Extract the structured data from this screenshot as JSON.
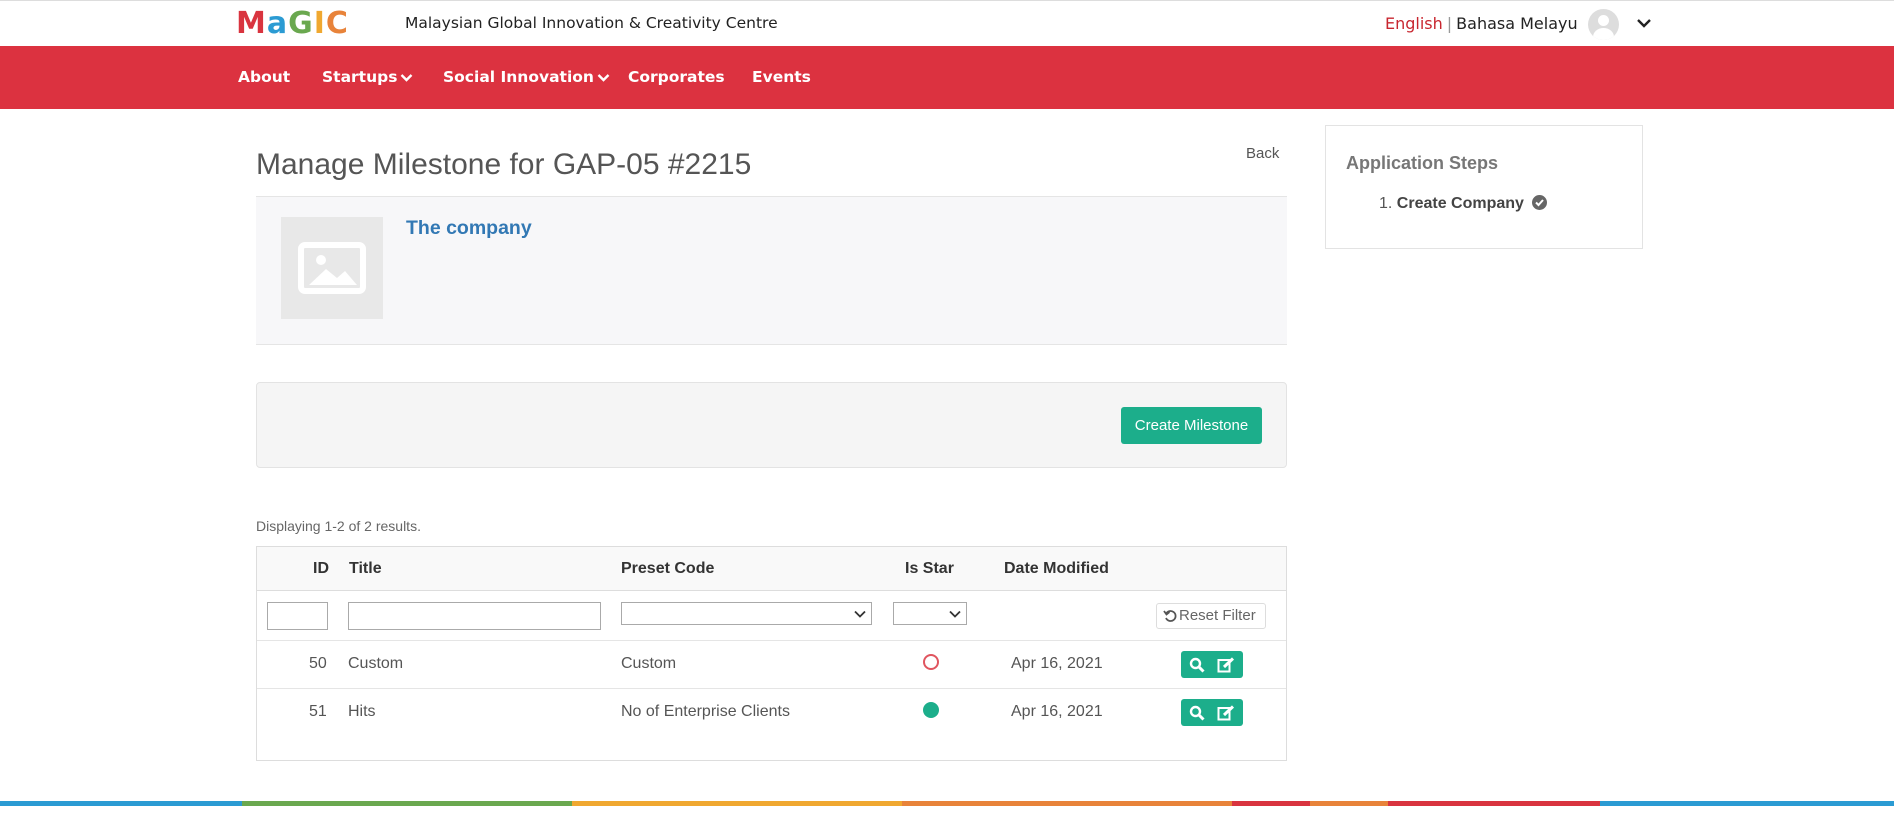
{
  "header": {
    "logo_letters": [
      "M",
      "a",
      "G",
      "I",
      "C"
    ],
    "logo_colors": [
      "#d9343f",
      "#2b9bd3",
      "#6aa84f",
      "#f0a830",
      "#e8833a"
    ],
    "site_name": "Malaysian Global Innovation & Creativity Centre",
    "lang_english": "English",
    "lang_sep": "|",
    "lang_malay": "Bahasa Melayu"
  },
  "nav": {
    "items": [
      {
        "label": "About"
      },
      {
        "label": "Startups"
      },
      {
        "label": "Social Innovation"
      },
      {
        "label": "Corporates"
      },
      {
        "label": "Events"
      }
    ],
    "color": "#dc3240"
  },
  "page": {
    "title": "Manage Milestone for GAP-05 #2215",
    "back_label": "Back"
  },
  "company": {
    "name": "The company",
    "image_icon": "image-placeholder-icon"
  },
  "actions": {
    "create_label": "Create Milestone"
  },
  "grid": {
    "summary": "Displaying 1-2 of 2 results.",
    "columns": [
      "ID",
      "Title",
      "Preset Code",
      "Is Star",
      "Date Modified"
    ],
    "reset_label": "Reset Filter",
    "rows": [
      {
        "id": "50",
        "title": "Custom",
        "preset": "Custom",
        "star": false,
        "date": "Apr 16, 2021"
      },
      {
        "id": "51",
        "title": "Hits",
        "preset": "No of Enterprise Clients",
        "star": true,
        "date": "Apr 16, 2021"
      }
    ],
    "row_action_icons": [
      "search-icon",
      "edit-icon"
    ]
  },
  "sidebar": {
    "title": "Application Steps",
    "steps": [
      {
        "number": "1.",
        "label": "Create Company",
        "done": true
      }
    ]
  },
  "colors": {
    "accent": "#1cae8b",
    "link": "#3278b4"
  }
}
